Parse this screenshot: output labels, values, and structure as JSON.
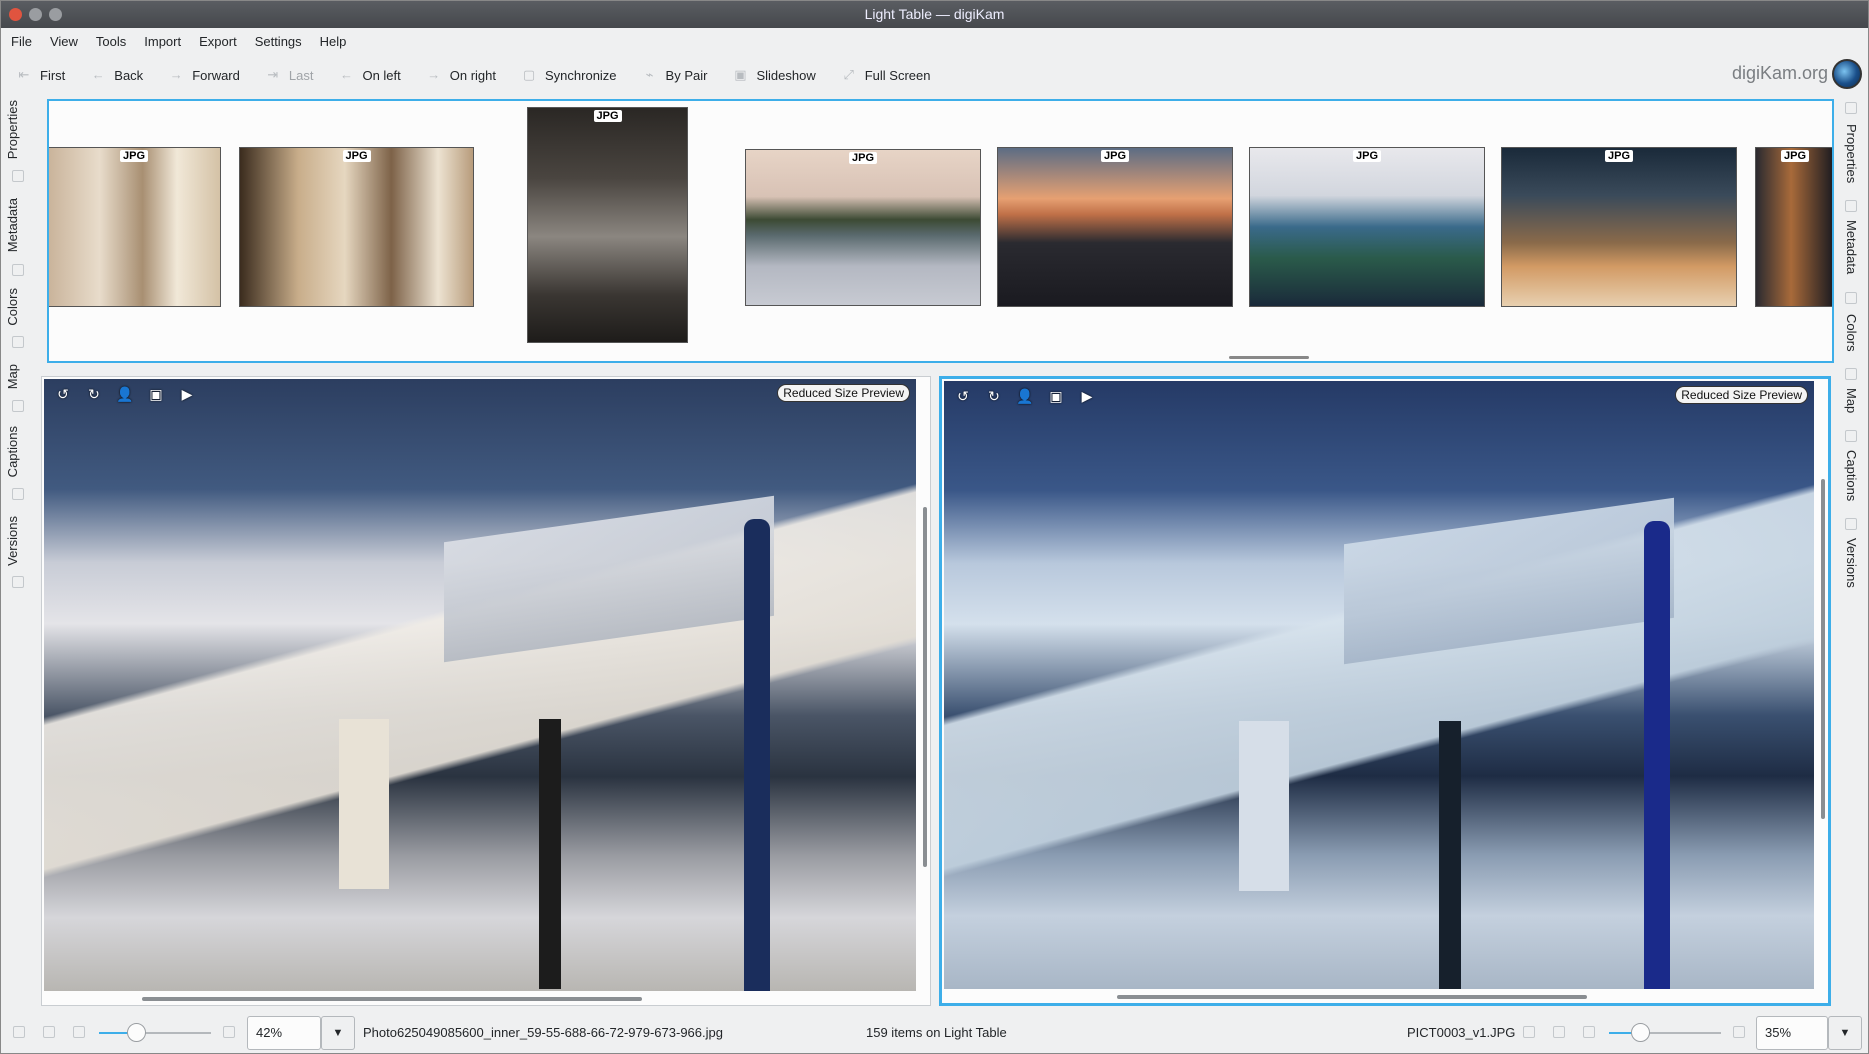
{
  "window": {
    "title": "Light Table — digiKam"
  },
  "menubar": {
    "items": [
      "File",
      "View",
      "Tools",
      "Import",
      "Export",
      "Settings",
      "Help"
    ]
  },
  "toolbar": {
    "buttons": [
      {
        "label": "First",
        "icon": "arrow-first-icon",
        "enabled": true
      },
      {
        "label": "Back",
        "icon": "arrow-left-icon",
        "enabled": true
      },
      {
        "label": "Forward",
        "icon": "arrow-right-icon",
        "enabled": true
      },
      {
        "label": "Last",
        "icon": "arrow-last-icon",
        "enabled": false
      },
      {
        "label": "On left",
        "icon": "arrow-left-icon",
        "enabled": true
      },
      {
        "label": "On right",
        "icon": "arrow-right-icon",
        "enabled": true
      },
      {
        "label": "Synchronize",
        "icon": "sync-icon",
        "enabled": true
      },
      {
        "label": "By Pair",
        "icon": "pair-icon",
        "enabled": true
      },
      {
        "label": "Slideshow",
        "icon": "slideshow-icon",
        "enabled": true
      },
      {
        "label": "Full Screen",
        "icon": "fullscreen-icon",
        "enabled": true
      }
    ],
    "brand": "digiKam.org"
  },
  "left_sidebar": {
    "tabs": [
      "Properties",
      "Metadata",
      "Colors",
      "Map",
      "Captions",
      "Versions"
    ]
  },
  "right_sidebar": {
    "tabs": [
      "Properties",
      "Metadata",
      "Colors",
      "Map",
      "Captions",
      "Versions"
    ]
  },
  "filmstrip": {
    "badge": "JPG",
    "thumbnails": [
      {
        "subject": "column-capital-closeup"
      },
      {
        "subject": "column-capital"
      },
      {
        "subject": "temple-shrine-with-person"
      },
      {
        "subject": "river-at-dusk"
      },
      {
        "subject": "sunset-deck"
      },
      {
        "subject": "boat-deck-crowd"
      },
      {
        "subject": "temple-ruins-night"
      },
      {
        "subject": "lit-temple-partial"
      }
    ]
  },
  "viewers": {
    "left": {
      "preview_label": "Reduced Size Preview",
      "filename": "Photo625049085600_inner_59-55-688-66-72-979-673-966.jpg",
      "zoom": "42%"
    },
    "right": {
      "preview_label": "Reduced Size Preview",
      "filename": "PICT0003_v1.JPG",
      "zoom": "35%"
    }
  },
  "status": {
    "items_count": "159 items on Light Table"
  },
  "colors": {
    "accent": "#3daee9",
    "background": "#eff0f1"
  }
}
